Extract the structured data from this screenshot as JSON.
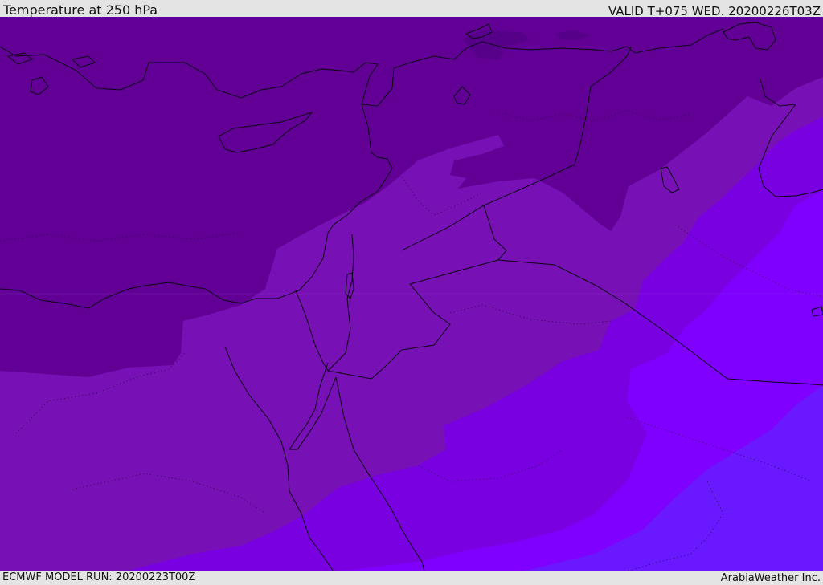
{
  "header": {
    "title": "Temperature at 250 hPa",
    "valid": "VALID T+075 WED. 20200226T03Z"
  },
  "footer": {
    "model_run": "ECMWF MODEL RUN: 20200223T00Z",
    "brand": "ArabiaWeather Inc."
  },
  "map": {
    "region": "Eastern Mediterranean / Middle East",
    "colors": {
      "band_darkest": "#620096",
      "band_dark": "#7811b5",
      "band_mid": "#7900e1",
      "band_light": "#7f00ff",
      "band_blue": "#6a18ff",
      "coastline": "#0a0014"
    }
  }
}
